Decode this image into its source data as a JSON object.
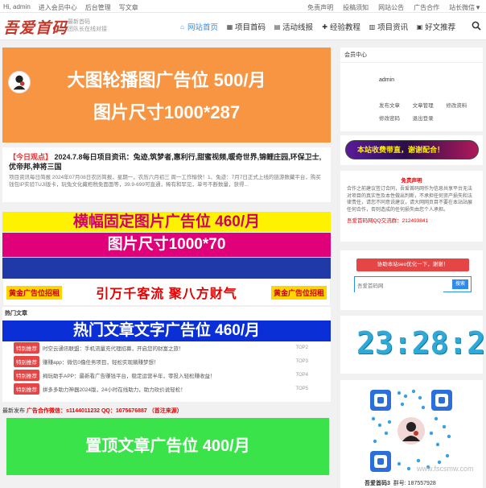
{
  "topbar": {
    "left": [
      "Hi, admin",
      "进入会员中心",
      "后台管理",
      "写文章"
    ],
    "right": [
      "免责声明",
      "投稿须知",
      "网站公告",
      "广告合作",
      "站长微信▼"
    ]
  },
  "header": {
    "logo": "吾爱首码",
    "slogan_1": "最新首码",
    "slogan_2": "团队长在线对接",
    "nav": [
      {
        "label": "网站首页",
        "icon": "home-icon",
        "glyph": "⌂"
      },
      {
        "label": "项目首码",
        "icon": "grid-icon",
        "glyph": "▦"
      },
      {
        "label": "活动线报",
        "icon": "newspaper-icon",
        "glyph": "▤"
      },
      {
        "label": "经验教程",
        "icon": "puzzle-icon",
        "glyph": "✚"
      },
      {
        "label": "项目资讯",
        "icon": "doc-icon",
        "glyph": "▥"
      },
      {
        "label": "好文推荐",
        "icon": "book-icon",
        "glyph": "▣"
      }
    ]
  },
  "ads": {
    "banner_1": "大图轮播图广告位 500/月",
    "banner_2": "图片尺寸1000*287",
    "strip_1": "横幅固定图片广告位 460/月",
    "strip_2": "图片尺寸1000*70",
    "gold_left": "黄金广告位招租",
    "gold_mid": "引万千客流  聚八方财气",
    "gold_right": "黄金广告位招租",
    "hot_text": "热门文章文字广告位 460/月",
    "top_article": "置顶文章广告位 400/月"
  },
  "news": {
    "tag": "【今日观点】",
    "title": "2024.7.8每日项目资讯：兔迹,筑梦者,惠利行,甜蜜视频,暖奇世界,锦鲤庄园,环保卫士,优帝邦,神将三国",
    "desc": "项目资讯每日简报 2024年07月08日农历简报，星期一，农历六月初三 周一工作愉快！1、兔迹：7月7日正式上线的链游数藏平台，购买钱包IP实验TUJI版卡，玩兔文化藏柜税免面面等，39.9-699可直通，稀有和罕见，单号不断数量，获得..."
  },
  "hot": {
    "heading": "热门文章",
    "rows": [
      {
        "badge": "特别推荐",
        "text": "时空云通讯联盟：手机流量充代理招募，开启您的财富之旅！",
        "num": "TOP2"
      },
      {
        "badge": "特别推荐",
        "text": "赚赚app：微信0撸任务项目，轻松实现躺赚梦想！",
        "num": "TOP3"
      },
      {
        "badge": "特别推荐",
        "text": "拇玩助手APP：最新看广告赚钱平台，稳定运营半年，零投入轻松赚收益！",
        "num": "TOP4"
      },
      {
        "badge": "特别推荐",
        "text": "拼多多助力神器2024版，24小时在线助力，助力砍价说轻松！",
        "num": "TOP5"
      }
    ]
  },
  "publish": {
    "label": "最新发布",
    "contact": "广告合作微信：s1144011232  QQ：1075676887  （首注来源）"
  },
  "sidebar": {
    "member_title": "会员中心",
    "username": "admin",
    "links": [
      "发布文章",
      "文章管理",
      "修改资料",
      "修改密码",
      "退出登录"
    ],
    "marquee": "本站收费带直，谢谢配合！",
    "notice_title": "免责声明",
    "notice_text": "合作之前建议签订合同，吾爱首码网作为信息共享平台无法对项目的真实性及本性做出判断，不承担任何资产损失和法律责任，请您不同意说建议，请大网网页目不要在本站站展任何合作，否则造成的任何损失由您个人承担。",
    "notice_qq": "吾爱首码网QQ交流群：212493841",
    "seo_button": "协助本站seo优化一下，谢谢！",
    "seo_placeholder": "吾爱首码网",
    "seo_search": "搜索",
    "clock": "23:28:27",
    "qr_name": "吾爱首码3",
    "qr_group": "群号: 187557928",
    "watermark": "www.fscsmw.com"
  },
  "colors": {
    "accent": "#2d8cf0",
    "orange_ad": "#f79542",
    "green_ad": "#3be34b",
    "red": "#e64545"
  }
}
